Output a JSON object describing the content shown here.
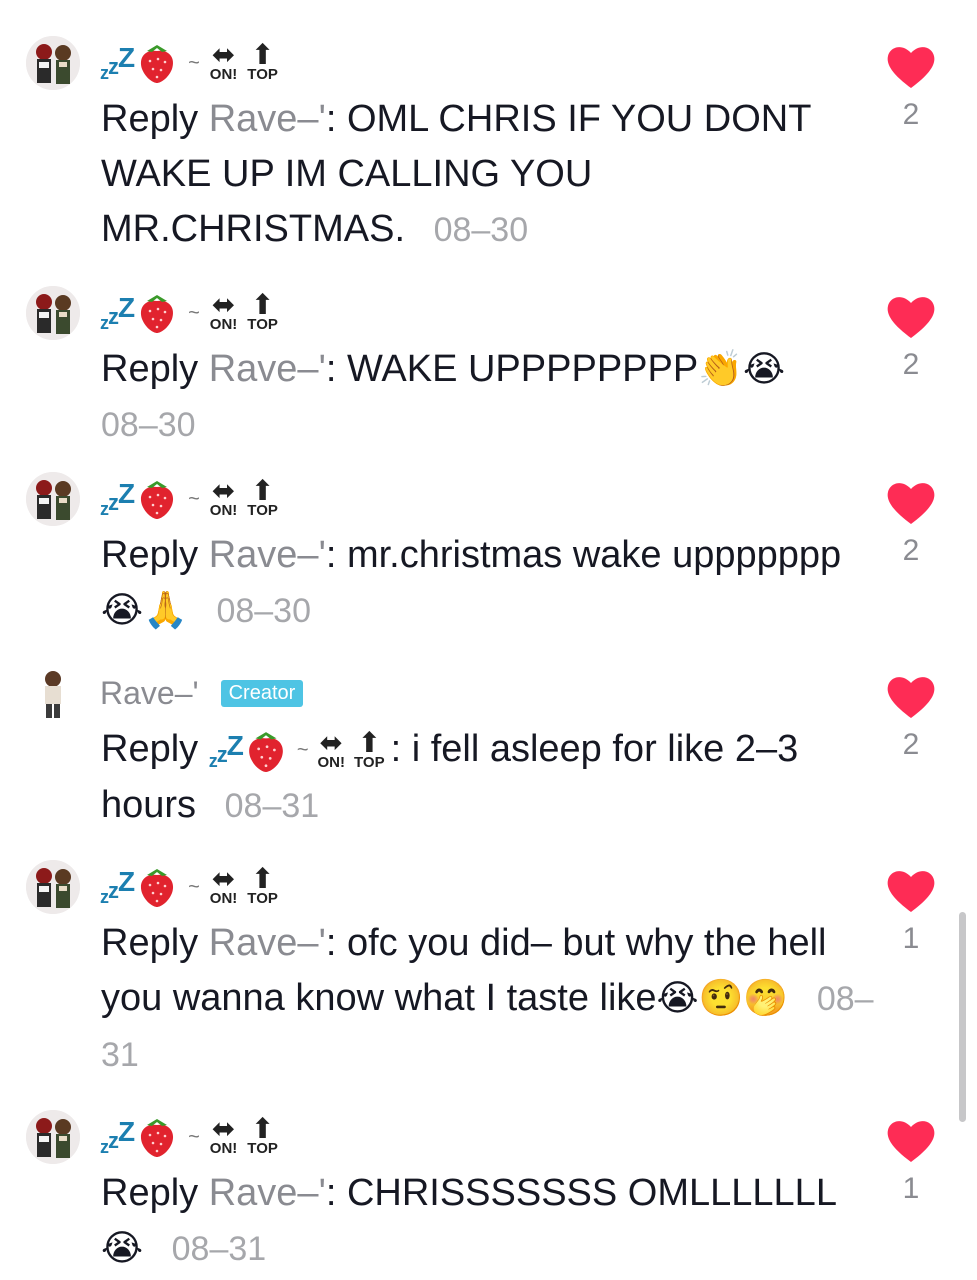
{
  "colors": {
    "heart": "#fe2c55",
    "creator_tag": "#4ec4e4",
    "muted": "#8a8b91"
  },
  "commenter": {
    "zzz": "zZZ",
    "tilde": "~",
    "badge_on": "ON!",
    "badge_top": "TOP",
    "badge_on_icon": "left-right-arrow-icon",
    "badge_top_icon": "up-arrow-icon"
  },
  "creator": {
    "name": "Rave–'",
    "tag": "Creator"
  },
  "comments": [
    {
      "reply": "Reply",
      "target": "Rave–'",
      "text": ": OML CHRIS IF YOU DONT WAKE UP IM CALLING YOU MR.CHRISTMAS.",
      "date": "08–30",
      "likes": "2"
    },
    {
      "reply": "Reply",
      "target": "Rave–'",
      "text": ": WAKE UPPPPPPPP",
      "emoji": "👏😭",
      "date": "08–30",
      "likes": "2"
    },
    {
      "reply": "Reply",
      "target": "Rave–'",
      "text": ": mr.christmas wake uppppppp",
      "emoji": "😭🙏",
      "date": "08–30",
      "likes": "2"
    },
    {
      "reply": "Reply",
      "text": ": i fell asleep for like 2–3 hours",
      "date": "08–31",
      "likes": "2"
    },
    {
      "reply": "Reply",
      "target": "Rave–'",
      "text": ": ofc you did– but why the hell you wanna know what I taste like",
      "emoji": "😭🤨🤭",
      "date": "08–31",
      "likes": "1"
    },
    {
      "reply": "Reply",
      "target": "Rave–'",
      "text": ": CHRISSSSSSS OMLLLLLLL",
      "emoji": "😭",
      "date": "08–31",
      "likes": "1"
    }
  ]
}
